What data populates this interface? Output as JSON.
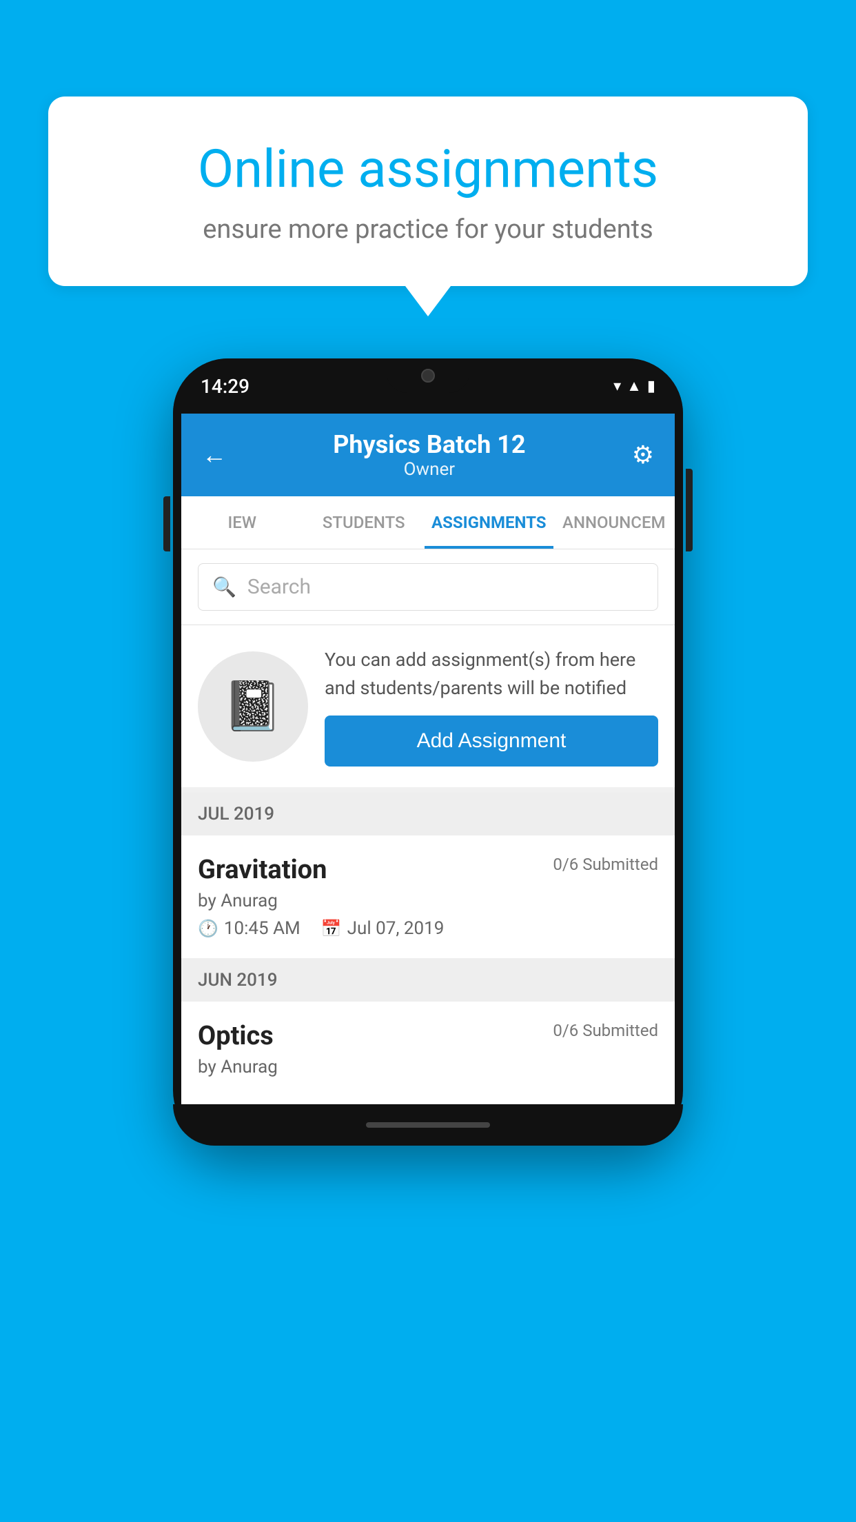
{
  "background_color": "#00AEEF",
  "speech_bubble": {
    "title": "Online assignments",
    "subtitle": "ensure more practice for your students"
  },
  "phone": {
    "status_bar": {
      "time": "14:29"
    },
    "header": {
      "title": "Physics Batch 12",
      "subtitle": "Owner",
      "back_label": "←",
      "settings_label": "⚙"
    },
    "tabs": [
      {
        "label": "IEW",
        "active": false
      },
      {
        "label": "STUDENTS",
        "active": false
      },
      {
        "label": "ASSIGNMENTS",
        "active": true
      },
      {
        "label": "ANNOUNCEM",
        "active": false
      }
    ],
    "search": {
      "placeholder": "Search"
    },
    "add_assignment_card": {
      "description": "You can add assignment(s) from here and students/parents will be notified",
      "button_label": "Add Assignment"
    },
    "assignment_groups": [
      {
        "month_label": "JUL 2019",
        "assignments": [
          {
            "name": "Gravitation",
            "submitted": "0/6 Submitted",
            "author": "by Anurag",
            "time": "10:45 AM",
            "date": "Jul 07, 2019"
          }
        ]
      },
      {
        "month_label": "JUN 2019",
        "assignments": [
          {
            "name": "Optics",
            "submitted": "0/6 Submitted",
            "author": "by Anurag",
            "time": "",
            "date": ""
          }
        ]
      }
    ]
  }
}
